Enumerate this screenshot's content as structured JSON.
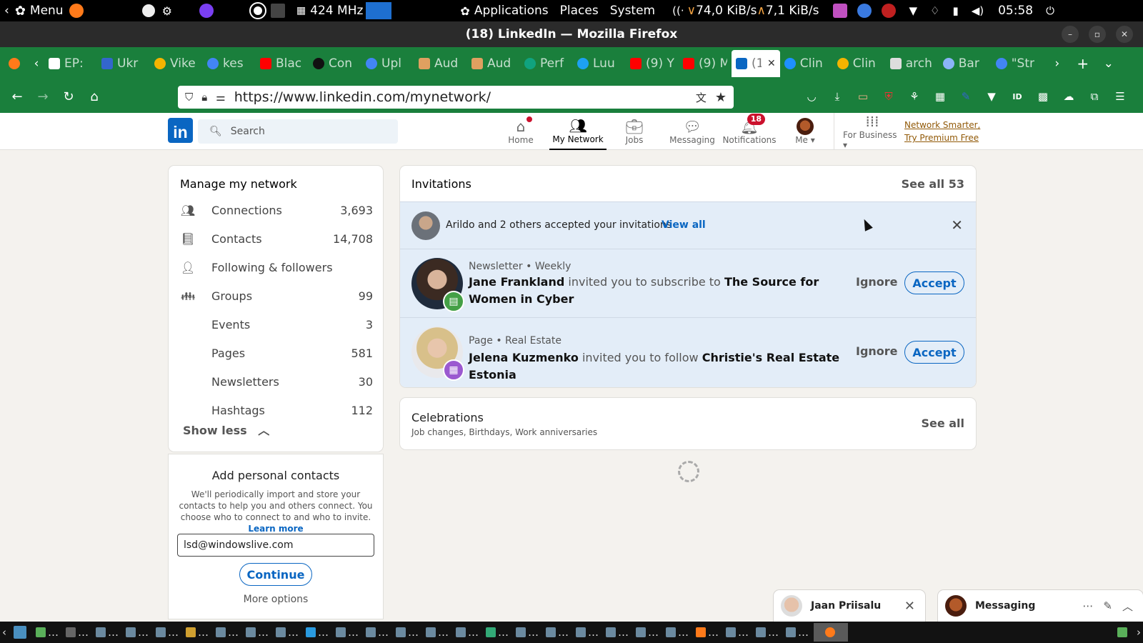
{
  "system_panel": {
    "menu_label": "Menu",
    "cpu_freq": "424 MHz",
    "applications": "Applications",
    "places": "Places",
    "system": "System",
    "net_down": "74,0 KiB/s",
    "net_up": "7,1 KiB/s",
    "clock": "05:58"
  },
  "window": {
    "title": "(18) LinkedIn — Mozilla Firefox"
  },
  "browser": {
    "tabs": [
      {
        "label": "EP:",
        "icon_color": "#ffffff"
      },
      {
        "label": "Ukr",
        "icon_color": "#3366cc"
      },
      {
        "label": "Vike",
        "icon_color": "#f4b400"
      },
      {
        "label": "kes",
        "icon_color": "#4285f4"
      },
      {
        "label": "Blac",
        "icon_color": "#ff0000"
      },
      {
        "label": "Con",
        "icon_color": "#111111"
      },
      {
        "label": "Upl",
        "icon_color": "#4285f4"
      },
      {
        "label": "Aud",
        "icon_color": "#e0a060"
      },
      {
        "label": "Aud",
        "icon_color": "#e0a060"
      },
      {
        "label": "Perf",
        "icon_color": "#10a37f"
      },
      {
        "label": "Luu",
        "icon_color": "#1da1f2"
      },
      {
        "label": "(9) Y",
        "icon_color": "#ff0000"
      },
      {
        "label": "(9) M",
        "icon_color": "#ff0000"
      },
      {
        "label": "(1",
        "icon_color": "#0a66c2",
        "active": true
      },
      {
        "label": "Clin",
        "icon_color": "#1e90ff"
      },
      {
        "label": "Clin",
        "icon_color": "#f4b400"
      },
      {
        "label": "arch",
        "icon_color": "#ffffff"
      },
      {
        "label": "Bar",
        "icon_color": "#8ab4f8"
      },
      {
        "label": "\"Str",
        "icon_color": "#4285f4"
      }
    ],
    "url": "https://www.linkedin.com/mynetwork/"
  },
  "linkedin": {
    "search_placeholder": "Search",
    "nav": {
      "home": "Home",
      "my_network": "My Network",
      "jobs": "Jobs",
      "messaging": "Messaging",
      "notifications": "Notifications",
      "notifications_count": "18",
      "me": "Me",
      "for_business": "For Business",
      "premium_line1": "Network Smarter,",
      "premium_line2": "Try Premium Free"
    },
    "manage": {
      "title": "Manage my network",
      "items": [
        {
          "label": "Connections",
          "count": "3,693"
        },
        {
          "label": "Contacts",
          "count": "14,708"
        },
        {
          "label": "Following & followers",
          "count": ""
        },
        {
          "label": "Groups",
          "count": "99"
        },
        {
          "label": "Events",
          "count": "3"
        },
        {
          "label": "Pages",
          "count": "581"
        },
        {
          "label": "Newsletters",
          "count": "30"
        },
        {
          "label": "Hashtags",
          "count": "112"
        }
      ],
      "show_less": "Show less"
    },
    "contacts": {
      "title": "Add personal contacts",
      "description": "We'll periodically import and store your contacts to help you and others connect. You choose who to connect to and who to invite.",
      "learn_more": "Learn more",
      "email_value": "lsd@windowslive.com",
      "continue": "Continue",
      "more_options": "More options"
    },
    "invitations": {
      "title": "Invitations",
      "see_all": "See all 53",
      "accepted_text": "Arildo and 2 others accepted your invitations",
      "view_all": "View all",
      "items": [
        {
          "meta": "Newsletter • Weekly",
          "person": "Jane Frankland",
          "action": "invited you to subscribe to",
          "target": "The Source for Women in Cyber",
          "ignore": "Ignore",
          "accept": "Accept"
        },
        {
          "meta": "Page • Real Estate",
          "person": "Jelena Kuzmenko",
          "action": "invited you to follow",
          "target": "Christie's Real Estate Estonia",
          "ignore": "Ignore",
          "accept": "Accept"
        }
      ]
    },
    "celebrations": {
      "title": "Celebrations",
      "subtitle": "Job changes, Birthdays, Work anniversaries",
      "see_all": "See all"
    },
    "chat": {
      "jaan": "Jaan Priisalu",
      "messaging": "Messaging"
    }
  }
}
